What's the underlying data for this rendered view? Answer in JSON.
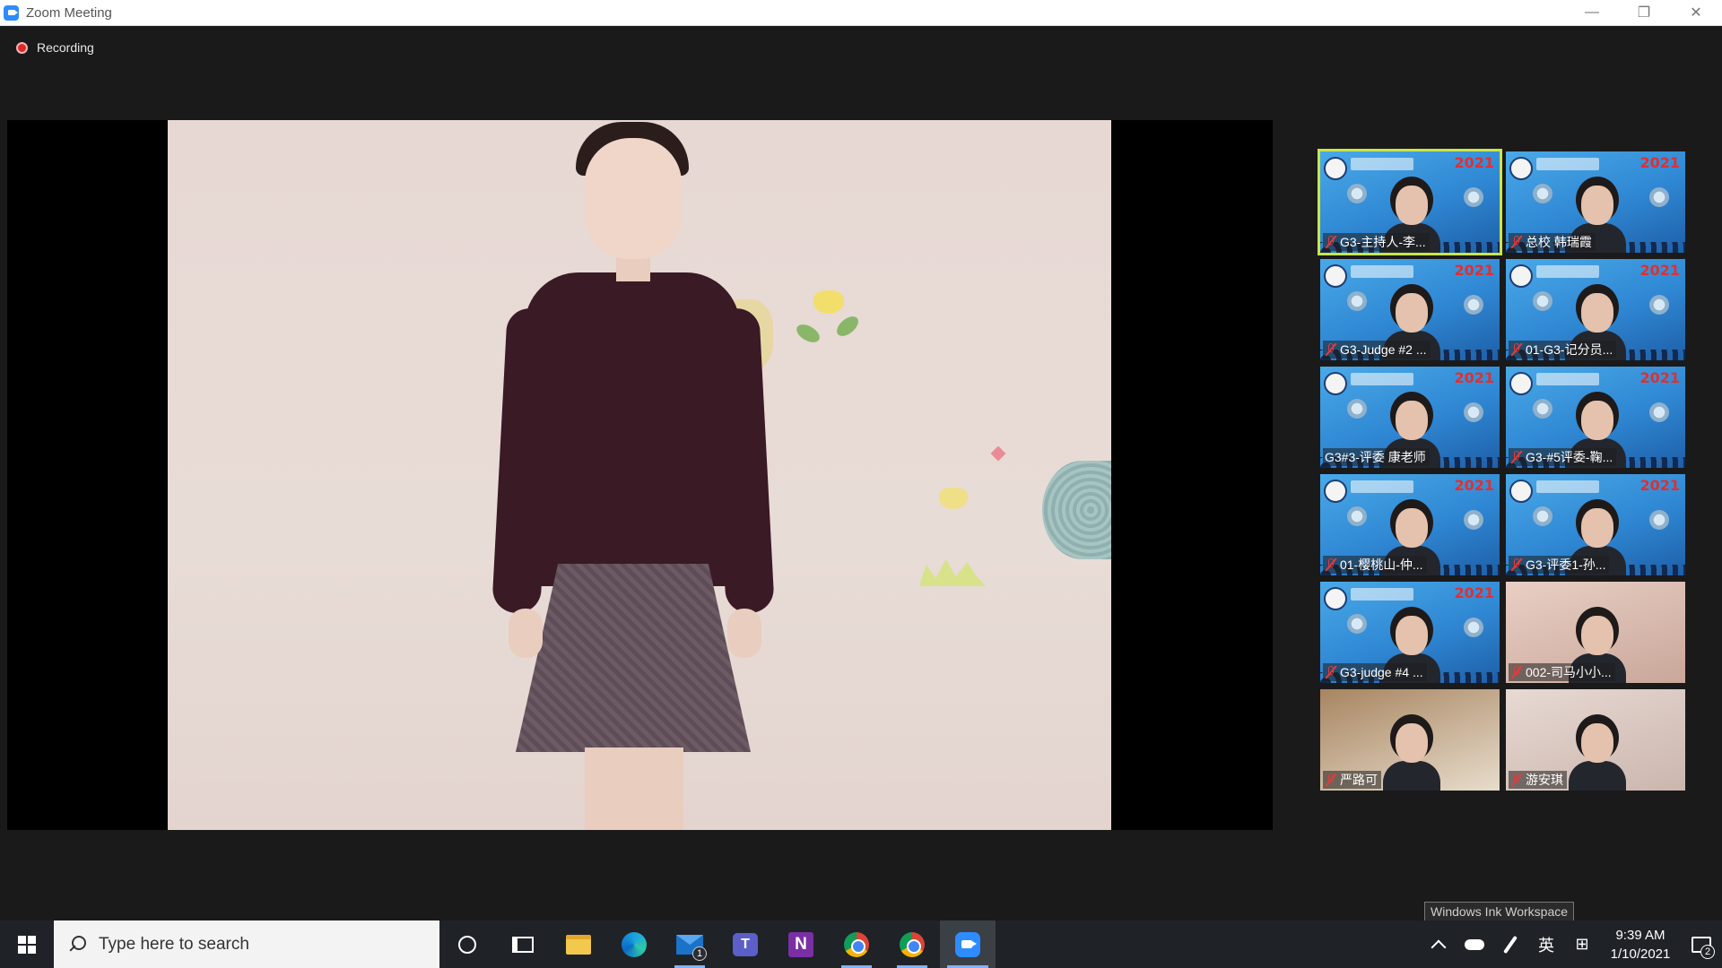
{
  "window": {
    "title": "Zoom Meeting",
    "minimize": "—",
    "restore": "❐",
    "close": "✕"
  },
  "meeting": {
    "recording_label": "Recording",
    "participants": [
      {
        "name": "G3-主持人-李...",
        "muted": true,
        "active": true,
        "background": "branded"
      },
      {
        "name": "总校 韩瑞霞",
        "muted": true,
        "active": false,
        "background": "branded"
      },
      {
        "name": "G3-Judge #2 ...",
        "muted": true,
        "active": false,
        "background": "branded"
      },
      {
        "name": "01-G3-记分员...",
        "muted": true,
        "active": false,
        "background": "branded"
      },
      {
        "name": "G3#3-评委 康老师",
        "muted": false,
        "active": false,
        "background": "branded"
      },
      {
        "name": "G3-#5评委-鞠...",
        "muted": true,
        "active": false,
        "background": "branded"
      },
      {
        "name": "01-樱桃山-仲...",
        "muted": true,
        "active": false,
        "background": "branded"
      },
      {
        "name": "G3-评委1-孙...",
        "muted": true,
        "active": false,
        "background": "branded"
      },
      {
        "name": "G3-judge #4 ...",
        "muted": true,
        "active": false,
        "background": "branded"
      },
      {
        "name": "002-司马小小...",
        "muted": true,
        "active": false,
        "background": "photo"
      },
      {
        "name": "严路可",
        "muted": true,
        "active": false,
        "background": "photo"
      },
      {
        "name": "游安琪",
        "muted": true,
        "active": false,
        "background": "photo"
      }
    ],
    "tile_year": "2021"
  },
  "taskbar": {
    "search_placeholder": "Type here to search",
    "mail_badge": "1",
    "onenote_letter": "N",
    "teams_letter": "T",
    "ime_label": "英",
    "ime_grid": "⊞",
    "time": "9:39 AM",
    "date": "1/10/2021",
    "notification_count": "2",
    "tooltip": "Windows Ink Workspace"
  },
  "colors": {
    "zoom_blue": "#2d8cff",
    "active_speaker_border": "#c8e64a",
    "recording_red": "#e02828",
    "muted_red": "#e43b3b"
  }
}
